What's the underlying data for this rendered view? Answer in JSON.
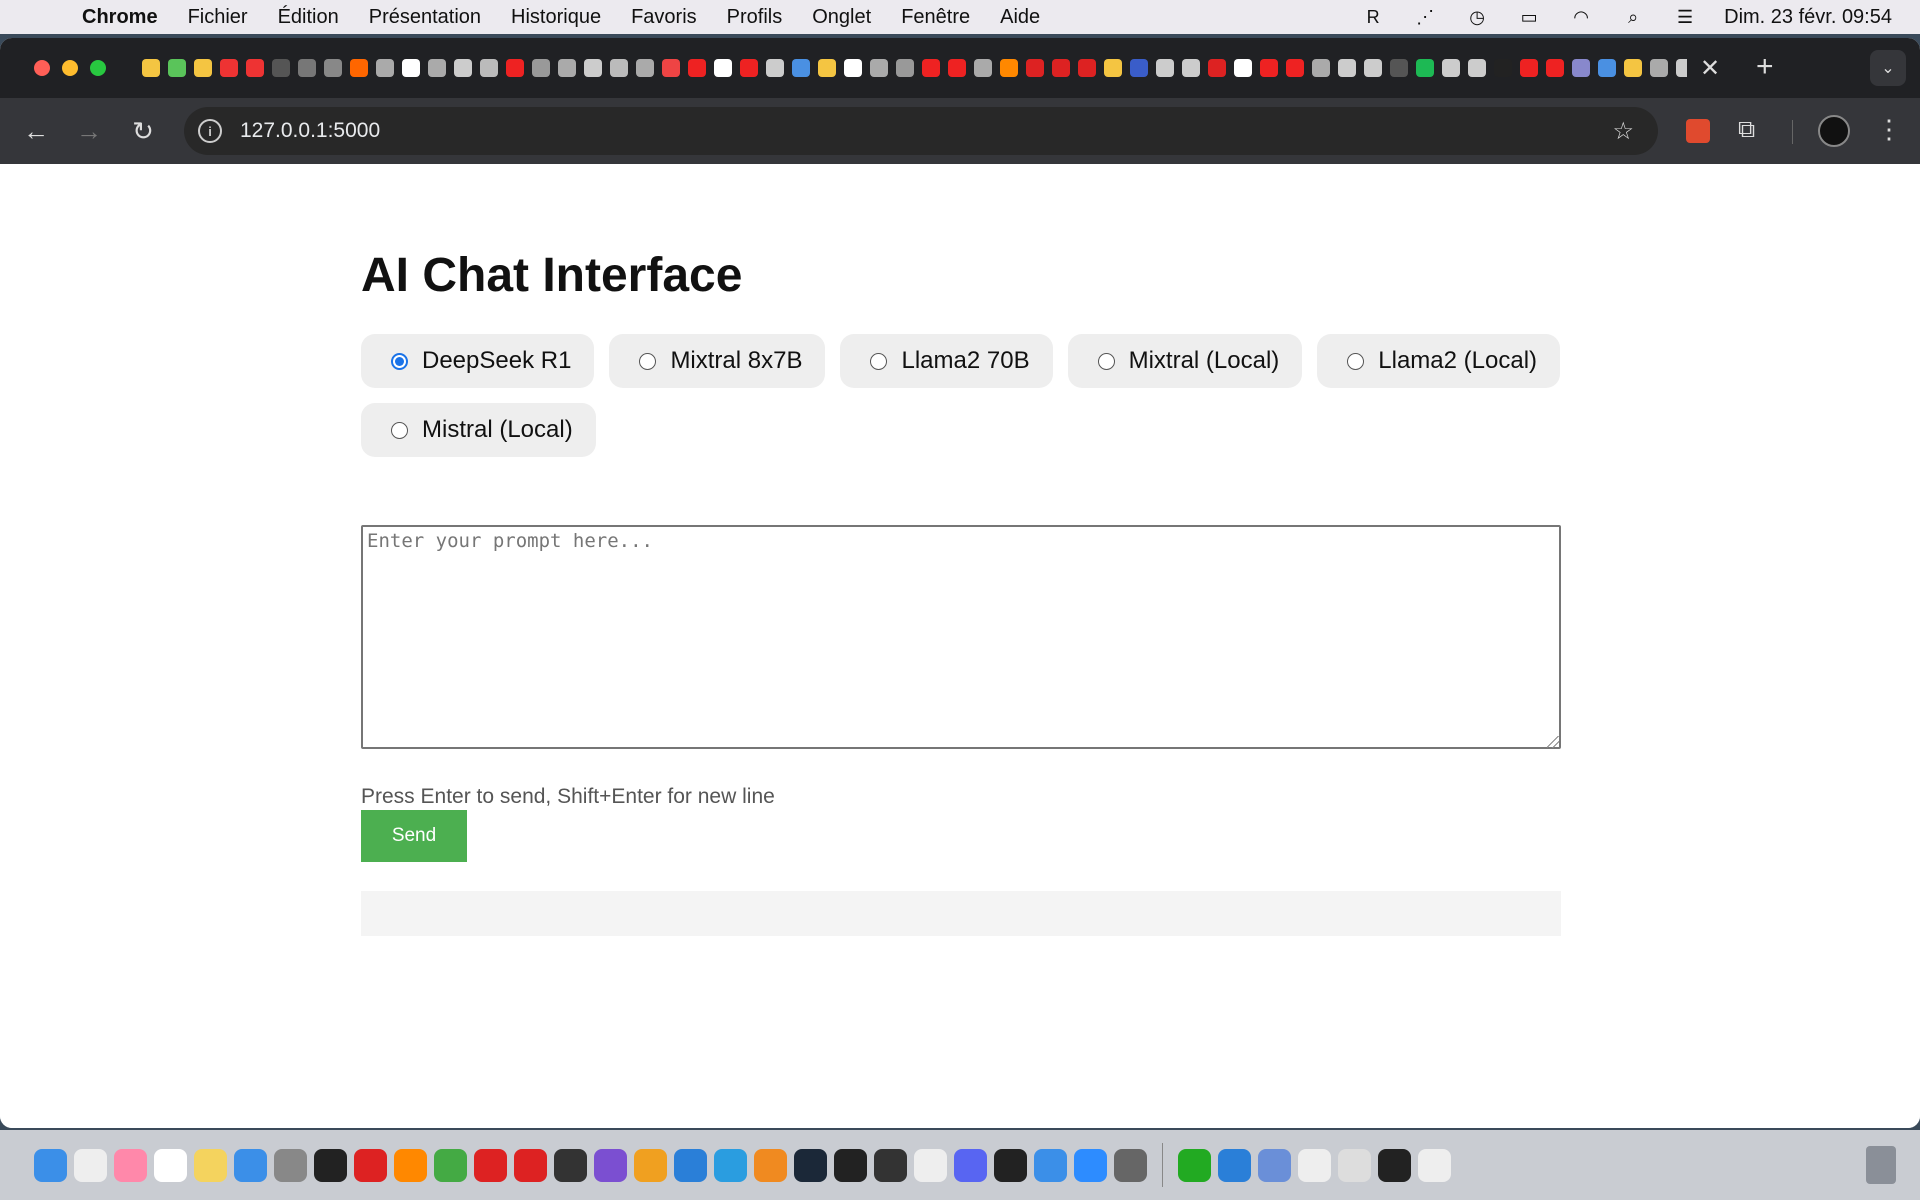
{
  "menubar": {
    "app_name": "Chrome",
    "items": [
      "Fichier",
      "Édition",
      "Présentation",
      "Historique",
      "Favoris",
      "Profils",
      "Onglet",
      "Fenêtre",
      "Aide"
    ],
    "clock": "Dim. 23 févr.  09:54"
  },
  "browser": {
    "url": "127.0.0.1:5000",
    "tab_favicon_colors": [
      "#f4c542",
      "#5ac45a",
      "#f4c542",
      "#e33",
      "#e33",
      "#555",
      "#777",
      "#888",
      "#f60",
      "#aaa",
      "#fff",
      "#aaa",
      "#ccc",
      "#bbb",
      "#e22",
      "#999",
      "#aaa",
      "#ccc",
      "#bbb",
      "#aaa",
      "#e44",
      "#e22",
      "#fff",
      "#e22",
      "#ccc",
      "#4a90e2",
      "#f4c542",
      "#fff",
      "#aaa",
      "#999",
      "#e22",
      "#e22",
      "#aaa",
      "#f80",
      "#d22",
      "#d22",
      "#d22",
      "#f4c542",
      "#3a5dc9",
      "#ccc",
      "#ccc",
      "#d22",
      "#fff",
      "#e22",
      "#e22",
      "#aaa",
      "#ccc",
      "#ccc",
      "#555",
      "#1db954",
      "#ccc",
      "#ccc",
      "#222",
      "#e22",
      "#e22",
      "#88c",
      "#4a90e2",
      "#f4c542",
      "#aaa",
      "#ccc",
      "#3b7bd1",
      "#3b7bd1",
      "#fff",
      "#ccc"
    ]
  },
  "page": {
    "title": "AI Chat Interface",
    "models": [
      {
        "label": "DeepSeek R1",
        "checked": true
      },
      {
        "label": "Mixtral 8x7B",
        "checked": false
      },
      {
        "label": "Llama2 70B",
        "checked": false
      },
      {
        "label": "Mixtral (Local)",
        "checked": false
      },
      {
        "label": "Llama2 (Local)",
        "checked": false
      },
      {
        "label": "Mistral (Local)",
        "checked": false
      }
    ],
    "prompt_placeholder": "Enter your prompt here...",
    "prompt_value": "",
    "hint": "Press Enter to send, Shift+Enter for new line",
    "send_label": "Send",
    "response_text": ""
  },
  "dock": {
    "icon_colors": [
      "#3b8fe8",
      "#eee",
      "#f8a",
      "#fff",
      "#f4d35e",
      "#3b8fe8",
      "#888",
      "#222",
      "#d22",
      "#f80",
      "#4a4",
      "#d22",
      "#d22",
      "#333",
      "#7b4fd1",
      "#f0a020",
      "#2a7fd8",
      "#2a9de0",
      "#f08a20",
      "#1b2838",
      "#222",
      "#333",
      "#eee",
      "#5865f2",
      "#222",
      "#3b8fe8",
      "#2d8cff",
      "#666",
      "#2a2",
      "#2a7fd8",
      "#6a8fd8",
      "#eee",
      "#ddd",
      "#222",
      "#eee"
    ]
  }
}
